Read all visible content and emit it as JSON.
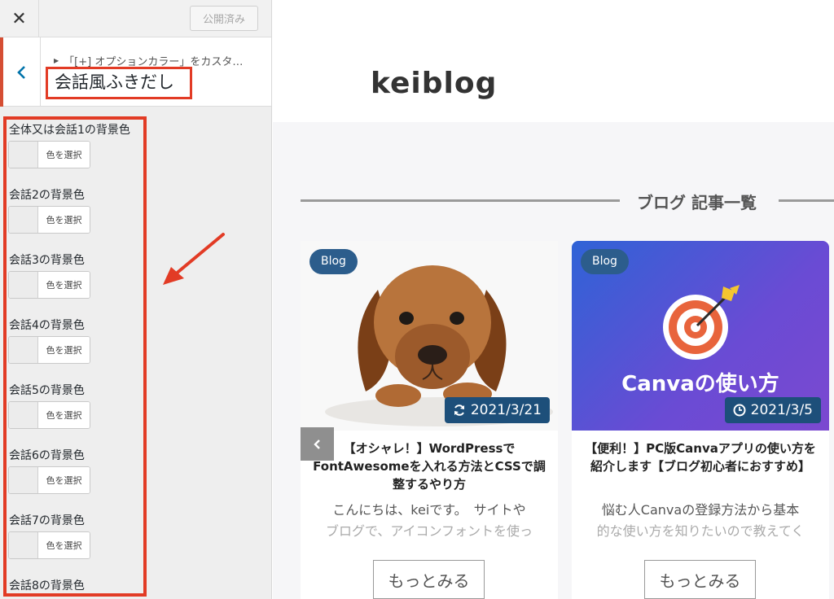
{
  "sidebar": {
    "close_symbol": "✕",
    "publish_label": "公開済み",
    "breadcrumb": "「[+] オプションカラー」をカスタ…",
    "section_title": "会話風ふきだし",
    "button_text": "色を選択",
    "controls": [
      {
        "label": "全体又は会話1の背景色"
      },
      {
        "label": "会話2の背景色"
      },
      {
        "label": "会話3の背景色"
      },
      {
        "label": "会話4の背景色"
      },
      {
        "label": "会話5の背景色"
      },
      {
        "label": "会話6の背景色"
      },
      {
        "label": "会話7の背景色"
      },
      {
        "label": "会話8の背景色"
      }
    ]
  },
  "preview": {
    "site_title": "keiblog",
    "section_heading": "ブログ 記事一覧",
    "cards": [
      {
        "badge": "Blog",
        "date": "2021/3/21",
        "date_icon": "refresh-icon",
        "title": "【オシャレ！】WordPressでFontAwesomeを入れる方法とCSSで調整するやり方",
        "excerpt_line1": "こんにちは、keiです。　サイトや",
        "excerpt_line2": "ブログで、アイコンフォントを使っ",
        "more": "もっとみる"
      },
      {
        "badge": "Blog",
        "date": "2021/3/5",
        "date_icon": "clock-icon",
        "image_text": "Canvaの使い方",
        "title": "【便利！】PC版Canvaアプリの使い方を紹介します【ブログ初心者におすすめ】",
        "excerpt_line1": "悩む人Canvaの登録方法から基本",
        "excerpt_line2": "的な使い方を知りたいので教えてく",
        "more": "もっとみる"
      }
    ]
  },
  "colors": {
    "accent_red": "#e23b25",
    "badge_blue": "#2c5d8c",
    "date_blue": "#1d4f7a"
  }
}
